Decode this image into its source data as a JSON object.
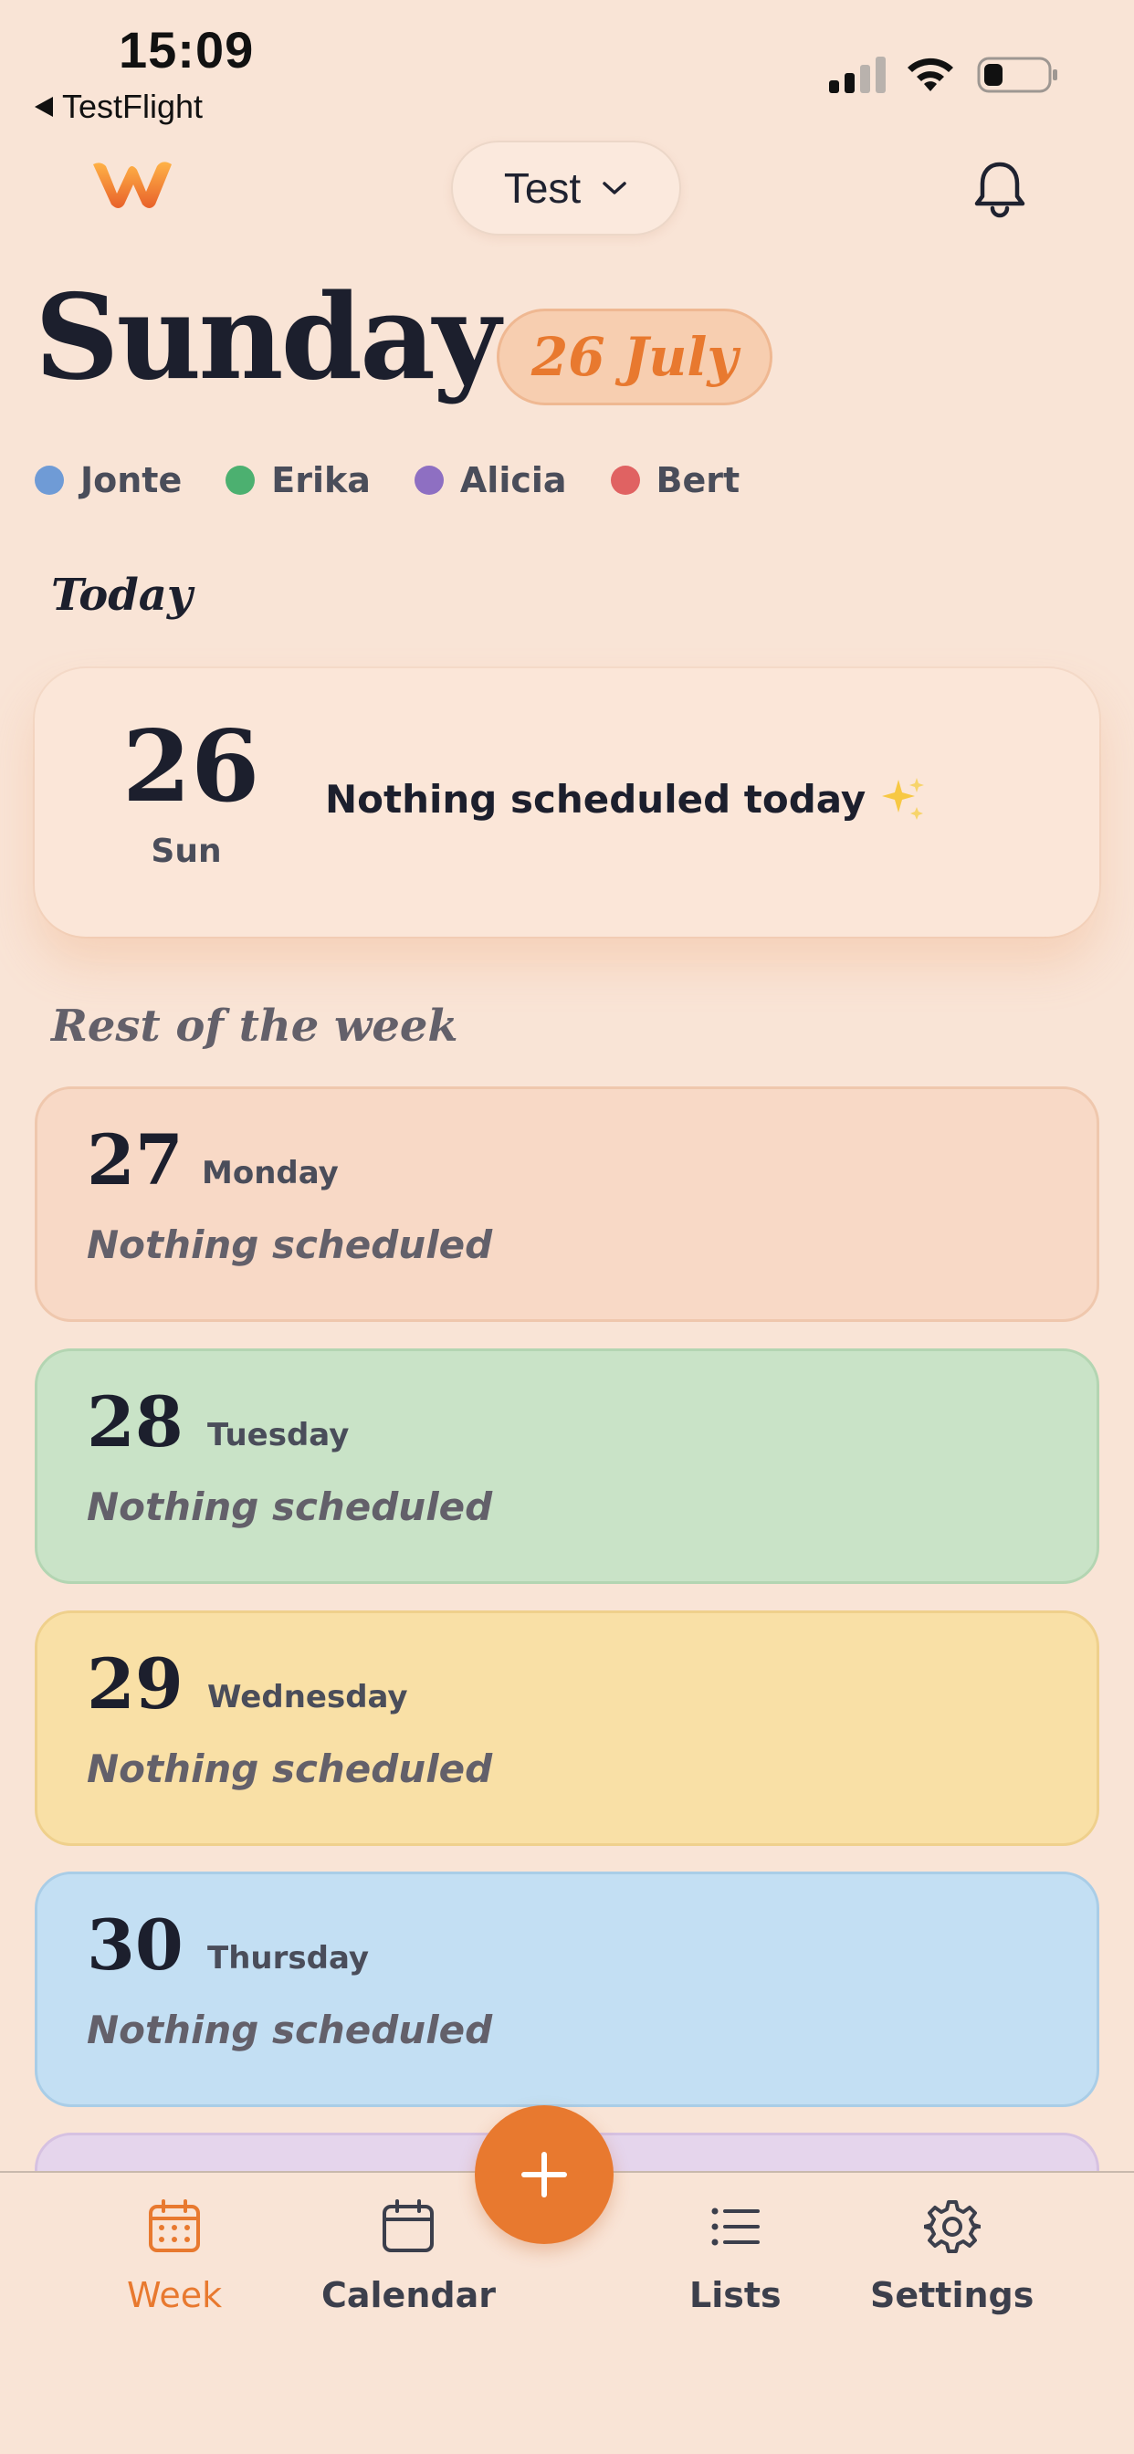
{
  "status_bar": {
    "time": "15:09",
    "back_label": "TestFlight"
  },
  "header": {
    "logo_icon": "w-logo-icon",
    "group_name": "Test",
    "notification_icon": "bell-icon"
  },
  "title": {
    "day": "Sunday",
    "date": "26 July"
  },
  "members": [
    {
      "name": "Jonte",
      "color": "#6f9bd6"
    },
    {
      "name": "Erika",
      "color": "#4cb070"
    },
    {
      "name": "Alicia",
      "color": "#8e6fc2"
    },
    {
      "name": "Bert",
      "color": "#e06262"
    }
  ],
  "today": {
    "section_label": "Today",
    "day_number": "26",
    "day_short": "Sun",
    "message": "Nothing scheduled today",
    "message_icon": "sparkles-icon"
  },
  "week": {
    "section_label": "Rest of the week",
    "days": [
      {
        "number": "27",
        "name": "Monday",
        "status": "Nothing scheduled",
        "bg": "#f8d9c6",
        "border": "#efc7ad"
      },
      {
        "number": "28",
        "name": "Tuesday",
        "status": "Nothing scheduled",
        "bg": "#c9e3c7",
        "border": "#b3d5b2"
      },
      {
        "number": "29",
        "name": "Wednesday",
        "status": "Nothing scheduled",
        "bg": "#f9e0a6",
        "border": "#efd08c"
      },
      {
        "number": "30",
        "name": "Thursday",
        "status": "Nothing scheduled",
        "bg": "#c3dff3",
        "border": "#a9cde7"
      },
      {
        "number": "",
        "name": "",
        "status": "",
        "bg": "#e5d5ec",
        "border": "#d6c1e1"
      }
    ]
  },
  "nav": {
    "items": [
      {
        "label": "Week",
        "icon": "calendar-week-icon",
        "active": true
      },
      {
        "label": "Calendar",
        "icon": "calendar-icon",
        "active": false
      },
      {
        "label": "Lists",
        "icon": "list-icon",
        "active": false
      },
      {
        "label": "Settings",
        "icon": "gear-icon",
        "active": false
      }
    ],
    "add_icon": "plus-icon"
  },
  "colors": {
    "accent": "#e8792f",
    "background": "#f9e4d6"
  }
}
